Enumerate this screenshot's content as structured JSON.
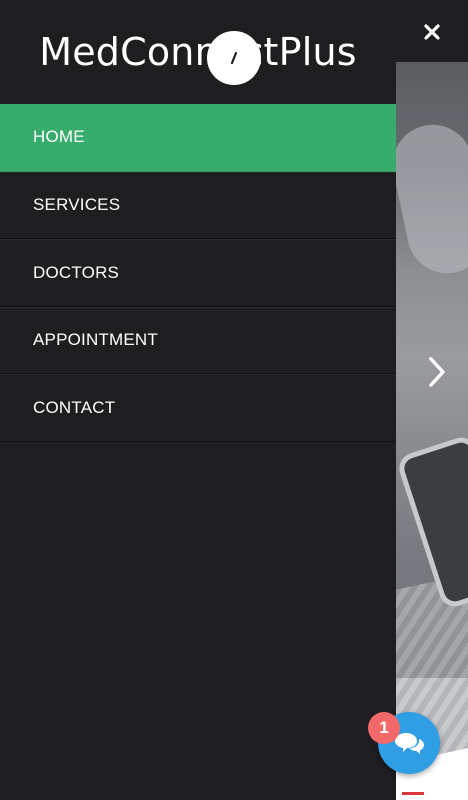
{
  "brand": {
    "title": "MedConnectPlus"
  },
  "menu": {
    "items": [
      {
        "label": "HOME",
        "active": true
      },
      {
        "label": "SERVICES",
        "active": false
      },
      {
        "label": "DOCTORS",
        "active": false
      },
      {
        "label": "APPOINTMENT",
        "active": false
      },
      {
        "label": "CONTACT",
        "active": false
      }
    ]
  },
  "chat": {
    "badge_count": "1"
  },
  "icons": {
    "close": "close-icon",
    "next": "chevron-right-icon",
    "chat": "chat-bubbles-icon"
  },
  "colors": {
    "drawer_bg": "#1e1e20",
    "active_item": "#36ad6c",
    "chat_button": "#2f9ee4",
    "badge": "#f36969"
  }
}
